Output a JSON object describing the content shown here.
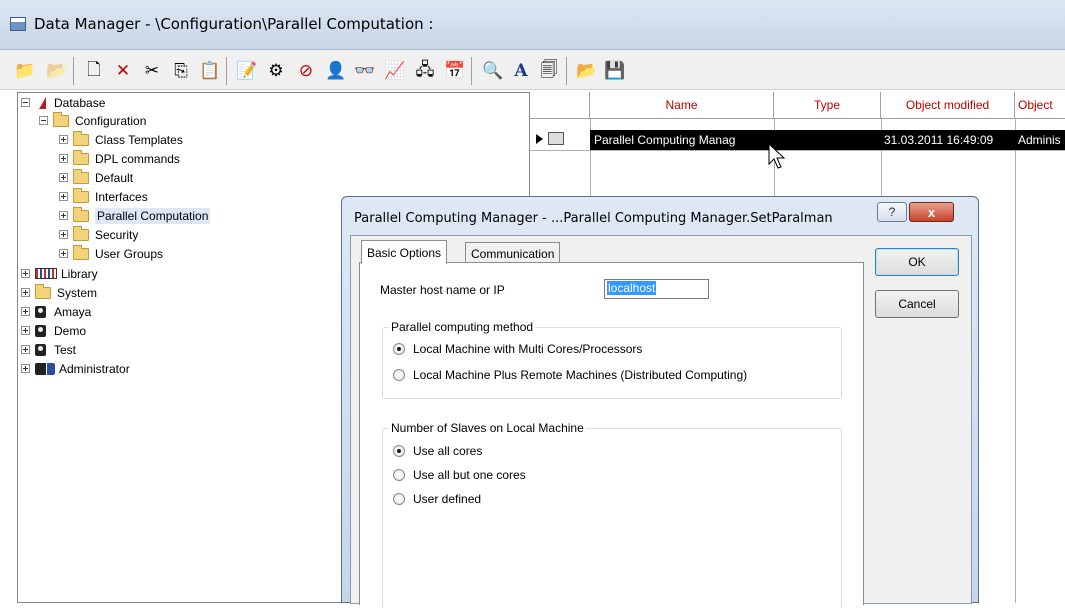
{
  "window": {
    "title": "Data Manager - \\Configuration\\Parallel Computation :"
  },
  "toolbar": {
    "icons": [
      "up-folder",
      "open-folder",
      "new-object",
      "delete",
      "cut",
      "copy",
      "paste",
      "edit",
      "settings",
      "stop",
      "find-user",
      "glasses",
      "chart",
      "network",
      "calendar",
      "find",
      "font",
      "edit-page",
      "open",
      "save"
    ]
  },
  "tree": {
    "items": [
      {
        "label": "Database"
      },
      {
        "label": "Configuration"
      },
      {
        "label": "Class Templates"
      },
      {
        "label": "DPL commands"
      },
      {
        "label": "Default"
      },
      {
        "label": "Interfaces"
      },
      {
        "label": "Parallel Computation"
      },
      {
        "label": "Security"
      },
      {
        "label": "User Groups"
      },
      {
        "label": "Library"
      },
      {
        "label": "System"
      },
      {
        "label": "Amaya"
      },
      {
        "label": "Demo"
      },
      {
        "label": "Test"
      },
      {
        "label": "Administrator"
      }
    ]
  },
  "grid": {
    "columns": [
      "Name",
      "Type",
      "Object modified",
      "Object"
    ],
    "rows": [
      {
        "name": "Parallel Computing Manag",
        "type": "",
        "modified": "31.03.2011 16:49:09",
        "object": "Adminis"
      }
    ]
  },
  "dialog": {
    "title": "Parallel Computing Manager - ...Parallel Computing Manager.SetParalman",
    "help_label": "?",
    "close_label": "x",
    "tabs": [
      "Basic Options",
      "Communication"
    ],
    "ok_label": "OK",
    "cancel_label": "Cancel",
    "master_host": {
      "label": "Master host name or IP",
      "value": "localhost"
    },
    "method": {
      "title": "Parallel computing method",
      "options": [
        {
          "label": "Local Machine with Multi Cores/Processors",
          "selected": true
        },
        {
          "label": "Local Machine Plus Remote Machines (Distributed Computing)",
          "selected": false
        }
      ]
    },
    "slaves": {
      "title": "Number of Slaves on Local Machine",
      "options": [
        {
          "label": "Use all cores",
          "selected": true
        },
        {
          "label": "Use all but one cores",
          "selected": false
        },
        {
          "label": "User defined",
          "selected": false
        }
      ]
    }
  }
}
